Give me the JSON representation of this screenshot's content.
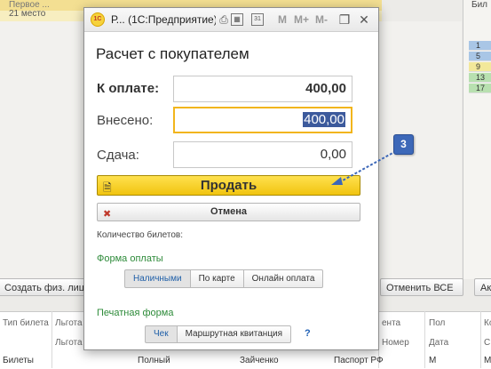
{
  "background": {
    "top_row_1": "Первое ...",
    "top_row_2": "21 место",
    "right_col_header": "Бил",
    "right_col_rows": [
      "1",
      "5",
      "9",
      "13",
      "17"
    ],
    "buttons": {
      "create_person": "Создать физ. лицо",
      "cancel_all": "Отменить ВСЕ",
      "extra": "Ак"
    },
    "table": {
      "header_row_1": [
        "Тип билета",
        "Льгота",
        "",
        "",
        "",
        "ента",
        "Пол",
        "Кол"
      ],
      "header_row_2": [
        "Льгота",
        "",
        "",
        "",
        "Номер",
        "Дата",
        "С"
      ],
      "row": {
        "col1": "Билеты",
        "col2": "Полный",
        "col3": "Зайченко",
        "col4": "Паспорт РФ",
        "col5": "М",
        "col6": "М"
      }
    }
  },
  "dialog": {
    "window_title": "Р... (1С:Предприятие)",
    "toolbar_m": "M",
    "toolbar_mplus": "M+",
    "toolbar_mminus": "M-",
    "heading": "Расчет с покупателем",
    "to_pay_label": "К оплате:",
    "to_pay_value": "400,00",
    "paid_label": "Внесено:",
    "paid_value": "400,00",
    "change_label": "Сдача:",
    "change_value": "0,00",
    "sell_button": "Продать",
    "cancel_button": "Отмена",
    "tickets_count_label": "Количество билетов:",
    "payment_form_label": "Форма оплаты",
    "payment_options": [
      "Наличными",
      "По карте",
      "Онлайн оплата"
    ],
    "payment_selected": "Наличными",
    "print_form_label": "Печатная форма",
    "print_options": [
      "Чек",
      "Маршрутная квитанция"
    ],
    "print_selected": "Чек",
    "help": "?"
  },
  "callout": {
    "number": "3"
  },
  "colors": {
    "sell_button": "#f1c40f",
    "active_field_border": "#f2b51c",
    "selection": "#3c5a9c",
    "group_label": "#2e8b3a",
    "callout": "#3d68b8"
  }
}
